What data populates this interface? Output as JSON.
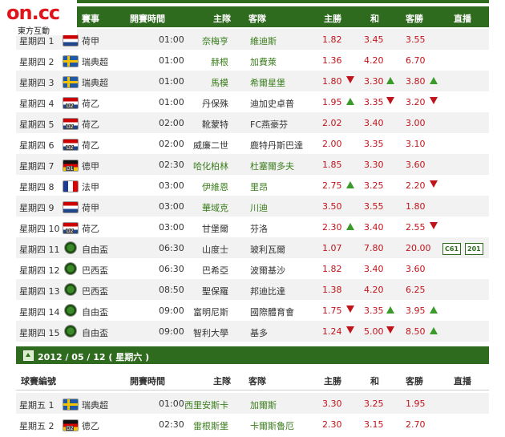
{
  "logo": {
    "brand": "on.cc",
    "sub": "東方互動"
  },
  "columns": {
    "match": "賽事",
    "time": "開賽時間",
    "home": "主隊",
    "vs": "客隊",
    "home_win": "主勝",
    "draw": "和",
    "away_win": "客勝",
    "tv": "直播"
  },
  "columns2": {
    "match": "球賽編號",
    "time": "開賽時間",
    "home": "主隊",
    "vs": "客隊",
    "home_win": "主勝",
    "draw": "和",
    "away_win": "客勝",
    "tv": "直播"
  },
  "date_bar": "2012 / 05 / 12 ( 星期六 )",
  "rows": [
    {
      "day": "星期四 1",
      "flag": "nl",
      "div": "",
      "league": "荷甲",
      "time": "01:00",
      "home": "奈梅亨",
      "away": "維迪斯",
      "home_green": true,
      "away_green": true,
      "o1": "1.82",
      "od": "3.45",
      "o2": "3.55",
      "a1": "",
      "ad": "",
      "a2": ""
    },
    {
      "day": "星期四 2",
      "flag": "se",
      "div": "",
      "league": "瑞典超",
      "time": "01:00",
      "home": "赫根",
      "away": "加費萊",
      "home_green": true,
      "away_green": true,
      "o1": "1.36",
      "od": "4.20",
      "o2": "6.70",
      "a1": "",
      "ad": "",
      "a2": ""
    },
    {
      "day": "星期四 3",
      "flag": "se",
      "div": "",
      "league": "瑞典超",
      "time": "01:00",
      "home": "馬模",
      "away": "希爾星堡",
      "home_green": true,
      "away_green": true,
      "o1": "1.80",
      "od": "3.30",
      "o2": "3.80",
      "a1": "down",
      "ad": "up",
      "a2": "up"
    },
    {
      "day": "星期四 4",
      "flag": "nl",
      "div": "D2",
      "league": "荷乙",
      "time": "01:00",
      "home": "丹保殊",
      "away": "迪加史卓普",
      "home_green": false,
      "away_green": false,
      "o1": "1.95",
      "od": "3.35",
      "o2": "3.20",
      "a1": "up",
      "ad": "down",
      "a2": "down"
    },
    {
      "day": "星期四 5",
      "flag": "nl",
      "div": "D2",
      "league": "荷乙",
      "time": "02:00",
      "home": "靴蒙特",
      "away": "FC燕豪芬",
      "home_green": false,
      "away_green": false,
      "o1": "2.02",
      "od": "3.40",
      "o2": "3.00",
      "a1": "",
      "ad": "",
      "a2": ""
    },
    {
      "day": "星期四 6",
      "flag": "nl",
      "div": "D2",
      "league": "荷乙",
      "time": "02:00",
      "home": "威廉二世",
      "away": "鹿特丹斯巴達",
      "home_green": false,
      "away_green": false,
      "o1": "2.00",
      "od": "3.35",
      "o2": "3.10",
      "a1": "",
      "ad": "",
      "a2": ""
    },
    {
      "day": "星期四 7",
      "flag": "de",
      "div": "D1",
      "league": "德甲",
      "time": "02:30",
      "home": "哈化柏林",
      "away": "杜塞爾多夫",
      "home_green": true,
      "away_green": true,
      "o1": "1.85",
      "od": "3.30",
      "o2": "3.60",
      "a1": "",
      "ad": "",
      "a2": ""
    },
    {
      "day": "星期四 8",
      "flag": "fr",
      "div": "",
      "league": "法甲",
      "time": "03:00",
      "home": "伊維恩",
      "away": "里昂",
      "home_green": true,
      "away_green": true,
      "o1": "2.75",
      "od": "3.25",
      "o2": "2.20",
      "a1": "up",
      "ad": "",
      "a2": "down"
    },
    {
      "day": "星期四 9",
      "flag": "nl",
      "div": "",
      "league": "荷甲",
      "time": "03:00",
      "home": "華域克",
      "away": "川迪",
      "home_green": true,
      "away_green": true,
      "o1": "3.50",
      "od": "3.55",
      "o2": "1.80",
      "a1": "",
      "ad": "",
      "a2": ""
    },
    {
      "day": "星期四 10",
      "flag": "nl",
      "div": "D2",
      "league": "荷乙",
      "time": "03:00",
      "home": "甘堡爾",
      "away": "芬洛",
      "home_green": false,
      "away_green": false,
      "o1": "2.30",
      "od": "3.40",
      "o2": "2.55",
      "a1": "up",
      "ad": "",
      "a2": "down"
    },
    {
      "day": "星期四 11",
      "flag": "cup",
      "div": "",
      "league": "自由盃",
      "time": "06:30",
      "home": "山度士",
      "away": "玻利瓦爾",
      "home_green": false,
      "away_green": false,
      "o1": "1.07",
      "od": "7.80",
      "o2": "20.00",
      "a1": "",
      "ad": "",
      "a2": "",
      "tv": [
        "C61",
        "201"
      ]
    },
    {
      "day": "星期四 12",
      "flag": "cup",
      "div": "",
      "league": "巴西盃",
      "time": "06:30",
      "home": "巴希亞",
      "away": "波爾基沙",
      "home_green": false,
      "away_green": false,
      "o1": "1.82",
      "od": "3.40",
      "o2": "3.60",
      "a1": "",
      "ad": "",
      "a2": ""
    },
    {
      "day": "星期四 13",
      "flag": "cup",
      "div": "",
      "league": "巴西盃",
      "time": "08:50",
      "home": "聖保羅",
      "away": "邦迪比達",
      "home_green": false,
      "away_green": false,
      "o1": "1.38",
      "od": "4.20",
      "o2": "6.25",
      "a1": "",
      "ad": "",
      "a2": ""
    },
    {
      "day": "星期四 14",
      "flag": "cup",
      "div": "",
      "league": "自由盃",
      "time": "09:00",
      "home": "富明尼斯",
      "away": "國際體育會",
      "home_green": false,
      "away_green": false,
      "o1": "1.75",
      "od": "3.35",
      "o2": "3.95",
      "a1": "down",
      "ad": "up",
      "a2": "up"
    },
    {
      "day": "星期四 15",
      "flag": "cup",
      "div": "",
      "league": "自由盃",
      "time": "09:00",
      "home": "智利大學",
      "away": "基多",
      "home_green": false,
      "away_green": false,
      "o1": "1.24",
      "od": "5.00",
      "o2": "8.50",
      "a1": "down",
      "ad": "down",
      "a2": "up"
    }
  ],
  "rows2": [
    {
      "day": "星期五 1",
      "flag": "se",
      "div": "",
      "league": "瑞典超",
      "time": "01:00",
      "home": "西里安斯卡",
      "away": "加爾斯",
      "home_green": true,
      "away_green": true,
      "o1": "3.30",
      "od": "3.25",
      "o2": "1.95",
      "a1": "",
      "ad": "",
      "a2": ""
    },
    {
      "day": "星期五 2",
      "flag": "de",
      "div": "D2",
      "league": "德乙",
      "time": "02:30",
      "home": "雷根斯堡",
      "away": "卡爾斯魯厄",
      "home_green": true,
      "away_green": true,
      "o1": "2.30",
      "od": "3.15",
      "o2": "2.70",
      "a1": "",
      "ad": "",
      "a2": ""
    }
  ]
}
